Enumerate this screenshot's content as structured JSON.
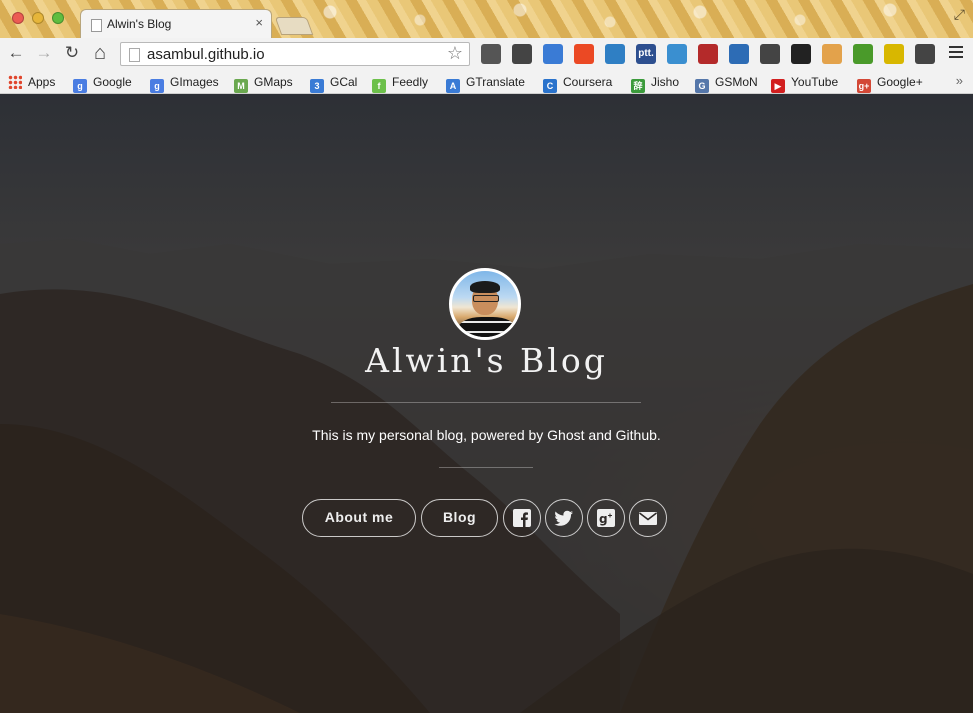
{
  "browser": {
    "tab": {
      "title": "Alwin's Blog",
      "close": "×"
    },
    "omnibox": {
      "url": "asambul.github.io"
    },
    "nav": {
      "back": "←",
      "forward": "→",
      "reload": "↻",
      "home": "⌂",
      "star": "☆"
    },
    "extensions": [
      {
        "icon": "evernote-icon",
        "color": "#555555"
      },
      {
        "icon": "pen-tool-icon",
        "color": "#444444"
      },
      {
        "icon": "translate-icon",
        "color": "#3a7bd5"
      },
      {
        "icon": "stumbleupon-icon",
        "color": "#eb4924"
      },
      {
        "icon": "screen-capture-icon",
        "color": "#2f7fc4"
      },
      {
        "icon": "ptt-icon",
        "label": "ptt.",
        "color": "#2d4f8f"
      },
      {
        "icon": "y-icon",
        "color": "#3a8fd0"
      },
      {
        "icon": "couch-icon",
        "color": "#b42a2a"
      },
      {
        "icon": "download-arrows-icon",
        "color": "#2d6cb5"
      },
      {
        "icon": "pencil-icon",
        "color": "#444444"
      },
      {
        "icon": "play-icon",
        "color": "#222222"
      },
      {
        "icon": "piggy-icon",
        "color": "#e3a24b"
      },
      {
        "icon": "green-download-icon",
        "color": "#4a9a2a"
      },
      {
        "icon": "send-to-phone-icon",
        "color": "#d8b700"
      },
      {
        "icon": "squares-icon",
        "color": "#444444"
      }
    ]
  },
  "bookmarks": [
    {
      "label": "Apps",
      "icon": "apps-grid-icon"
    },
    {
      "label": "Google",
      "icon": "google-icon",
      "glyph": "g",
      "color": "#4a7de2"
    },
    {
      "label": "GImages",
      "icon": "google-images-icon",
      "glyph": "g",
      "color": "#4a7de2"
    },
    {
      "label": "GMaps",
      "icon": "maps-icon",
      "glyph": "M",
      "color": "#6aa84f"
    },
    {
      "label": "GCal",
      "icon": "calendar-icon",
      "glyph": "3",
      "color": "#3a7bd5"
    },
    {
      "label": "Feedly",
      "icon": "feedly-icon",
      "glyph": "f",
      "color": "#6cc04a"
    },
    {
      "label": "GTranslate",
      "icon": "translate-icon",
      "glyph": "A",
      "color": "#3a7bd5"
    },
    {
      "label": "Coursera",
      "icon": "coursera-icon",
      "glyph": "C",
      "color": "#2a73cc"
    },
    {
      "label": "Jisho",
      "icon": "jisho-icon",
      "glyph": "辞",
      "color": "#3b9b3b"
    },
    {
      "label": "GSMoN",
      "icon": "gsmon-icon",
      "glyph": "G",
      "color": "#5577aa"
    },
    {
      "label": "YouTube",
      "icon": "youtube-icon",
      "glyph": "▶",
      "color": "#d21f1f"
    },
    {
      "label": "Google+",
      "icon": "google-plus-icon",
      "glyph": "g+",
      "color": "#d34836"
    }
  ],
  "bookmarks_overflow": "»",
  "hero": {
    "title": "Alwin's Blog",
    "tagline": "This is my personal blog, powered by Ghost and Github.",
    "buttons": {
      "about": "About me",
      "blog": "Blog"
    },
    "social": [
      "facebook-icon",
      "twitter-icon",
      "google-plus-icon",
      "mail-icon"
    ]
  }
}
